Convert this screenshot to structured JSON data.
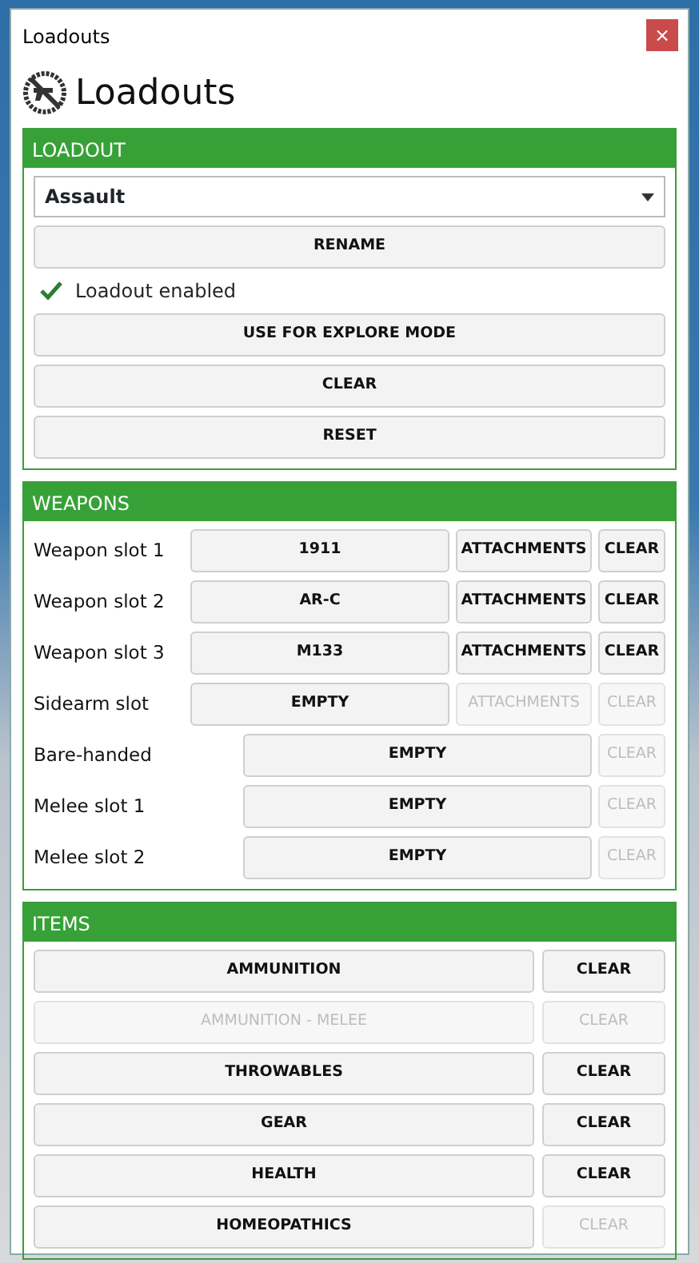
{
  "window": {
    "title": "Loadouts",
    "close": "×"
  },
  "heading": "Loadouts",
  "loadout": {
    "header": "LOADOUT",
    "selected_loadout": "Assault",
    "rename": "RENAME",
    "enabled": {
      "label": "Loadout enabled",
      "checked": true
    },
    "buttons": [
      {
        "label": "USE FOR EXPLORE MODE",
        "disabled": false
      },
      {
        "label": "CLEAR",
        "disabled": false
      },
      {
        "label": "RESET",
        "disabled": false
      }
    ]
  },
  "weapons": {
    "header": "WEAPONS",
    "slots": [
      {
        "kind": "weapon",
        "label": "Weapon slot 1",
        "value": "1911",
        "attachments": "ATTACHMENTS",
        "attachments_disabled": false,
        "clear": "CLEAR",
        "clear_disabled": false
      },
      {
        "kind": "weapon",
        "label": "Weapon slot 2",
        "value": "AR-C",
        "attachments": "ATTACHMENTS",
        "attachments_disabled": false,
        "clear": "CLEAR",
        "clear_disabled": false
      },
      {
        "kind": "weapon",
        "label": "Weapon slot 3",
        "value": "M133",
        "attachments": "ATTACHMENTS",
        "attachments_disabled": false,
        "clear": "CLEAR",
        "clear_disabled": false
      },
      {
        "kind": "weapon",
        "label": "Sidearm slot",
        "value": "EMPTY",
        "attachments": "ATTACHMENTS",
        "attachments_disabled": true,
        "clear": "CLEAR",
        "clear_disabled": true
      },
      {
        "kind": "simple",
        "label": "Bare-handed",
        "value": "EMPTY",
        "clear": "CLEAR",
        "clear_disabled": true
      },
      {
        "kind": "simple",
        "label": "Melee slot 1",
        "value": "EMPTY",
        "clear": "CLEAR",
        "clear_disabled": true
      },
      {
        "kind": "simple",
        "label": "Melee slot 2",
        "value": "EMPTY",
        "clear": "CLEAR",
        "clear_disabled": true
      }
    ]
  },
  "items": {
    "header": "ITEMS",
    "rows": [
      {
        "label": "AMMUNITION",
        "disabled": false,
        "clear": "CLEAR",
        "clear_disabled": false
      },
      {
        "label": "AMMUNITION - MELEE",
        "disabled": true,
        "clear": "CLEAR",
        "clear_disabled": true
      },
      {
        "label": "THROWABLES",
        "disabled": false,
        "clear": "CLEAR",
        "clear_disabled": false
      },
      {
        "label": "GEAR",
        "disabled": false,
        "clear": "CLEAR",
        "clear_disabled": false
      },
      {
        "label": "HEALTH",
        "disabled": false,
        "clear": "CLEAR",
        "clear_disabled": false
      },
      {
        "label": "HOMEOPATHICS",
        "disabled": false,
        "clear": "CLEAR",
        "clear_disabled": true
      }
    ]
  }
}
